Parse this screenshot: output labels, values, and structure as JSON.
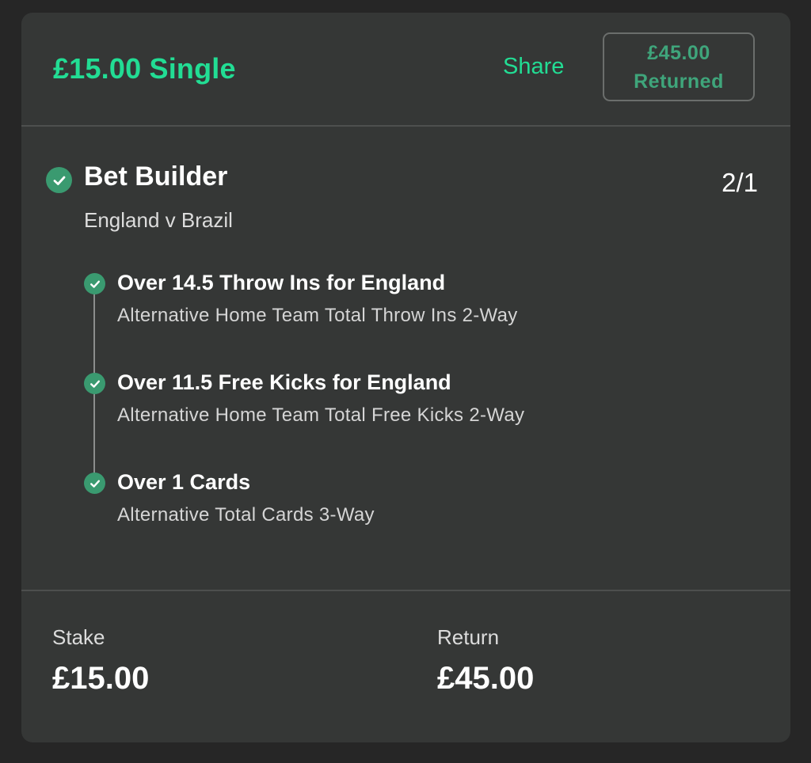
{
  "header": {
    "title": "£15.00 Single",
    "share_label": "Share",
    "returned_amount": "£45.00",
    "returned_label": "Returned"
  },
  "bet": {
    "title": "Bet Builder",
    "odds": "2/1",
    "match": "England v Brazil",
    "status_icon": "check-circle-icon",
    "legs": [
      {
        "title": "Over 14.5 Throw Ins for England",
        "market": "Alternative Home Team Total Throw Ins 2-Way",
        "status_icon": "check-circle-icon"
      },
      {
        "title": "Over 11.5 Free Kicks for England",
        "market": "Alternative Home Team Total Free Kicks 2-Way",
        "status_icon": "check-circle-icon"
      },
      {
        "title": "Over 1 Cards",
        "market": "Alternative Total Cards 3-Way",
        "status_icon": "check-circle-icon"
      }
    ]
  },
  "summary": {
    "stake_label": "Stake",
    "stake_value": "£15.00",
    "return_label": "Return",
    "return_value": "£45.00"
  },
  "colors": {
    "accent": "#22dd94",
    "check": "#3a9a70",
    "card_bg": "#353736",
    "page_bg": "#262626"
  }
}
